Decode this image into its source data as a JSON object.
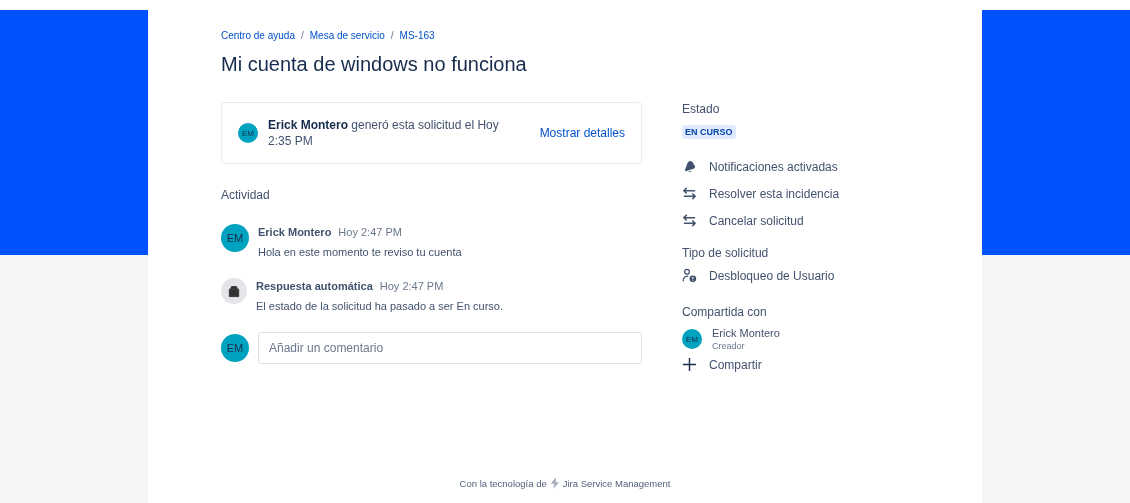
{
  "breadcrumbs": [
    "Centro de ayuda",
    "Mesa de servicio",
    "MS-163"
  ],
  "breadcrumb_separator": "/",
  "title": "Mi cuenta de windows no funciona",
  "summary": {
    "avatar": "EM",
    "text": "**Erick Montero** generó esta solicitud el Hoy 2:35 PM",
    "link": "Mostrar detalles"
  },
  "activity": {
    "heading": "Actividad",
    "items": [
      {
        "kind": "user",
        "avatar": "EM",
        "author": "Erick Montero",
        "time": "Hoy 2:47 PM",
        "message": "Hola en este momento te reviso tu cuenta"
      },
      {
        "kind": "bot",
        "author": "Respuesta automática",
        "time": "Hoy 2:47 PM",
        "message": "El estado de la solicitud ha pasado a ser En curso."
      }
    ],
    "comment": {
      "avatar": "EM",
      "placeholder": "Añadir un comentario"
    }
  },
  "sidebar": {
    "status_heading": "Estado",
    "status": "EN CURSO",
    "actions": [
      {
        "kind": "bell",
        "label": "Notificaciones activadas"
      },
      {
        "kind": "transition",
        "label": "Resolver esta incidencia"
      },
      {
        "kind": "transition",
        "label": "Cancelar solicitud"
      }
    ],
    "type_heading": "Tipo de solicitud",
    "type": "Desbloqueo de Usuario",
    "shared_heading": "Compartida con",
    "shared": [
      {
        "avatar": "EM",
        "name": "Erick Montero",
        "role": "Creador"
      }
    ],
    "share": "Compartir"
  },
  "footer": {
    "prefix": "Con la tecnología de",
    "product": "Jira Service Management"
  }
}
